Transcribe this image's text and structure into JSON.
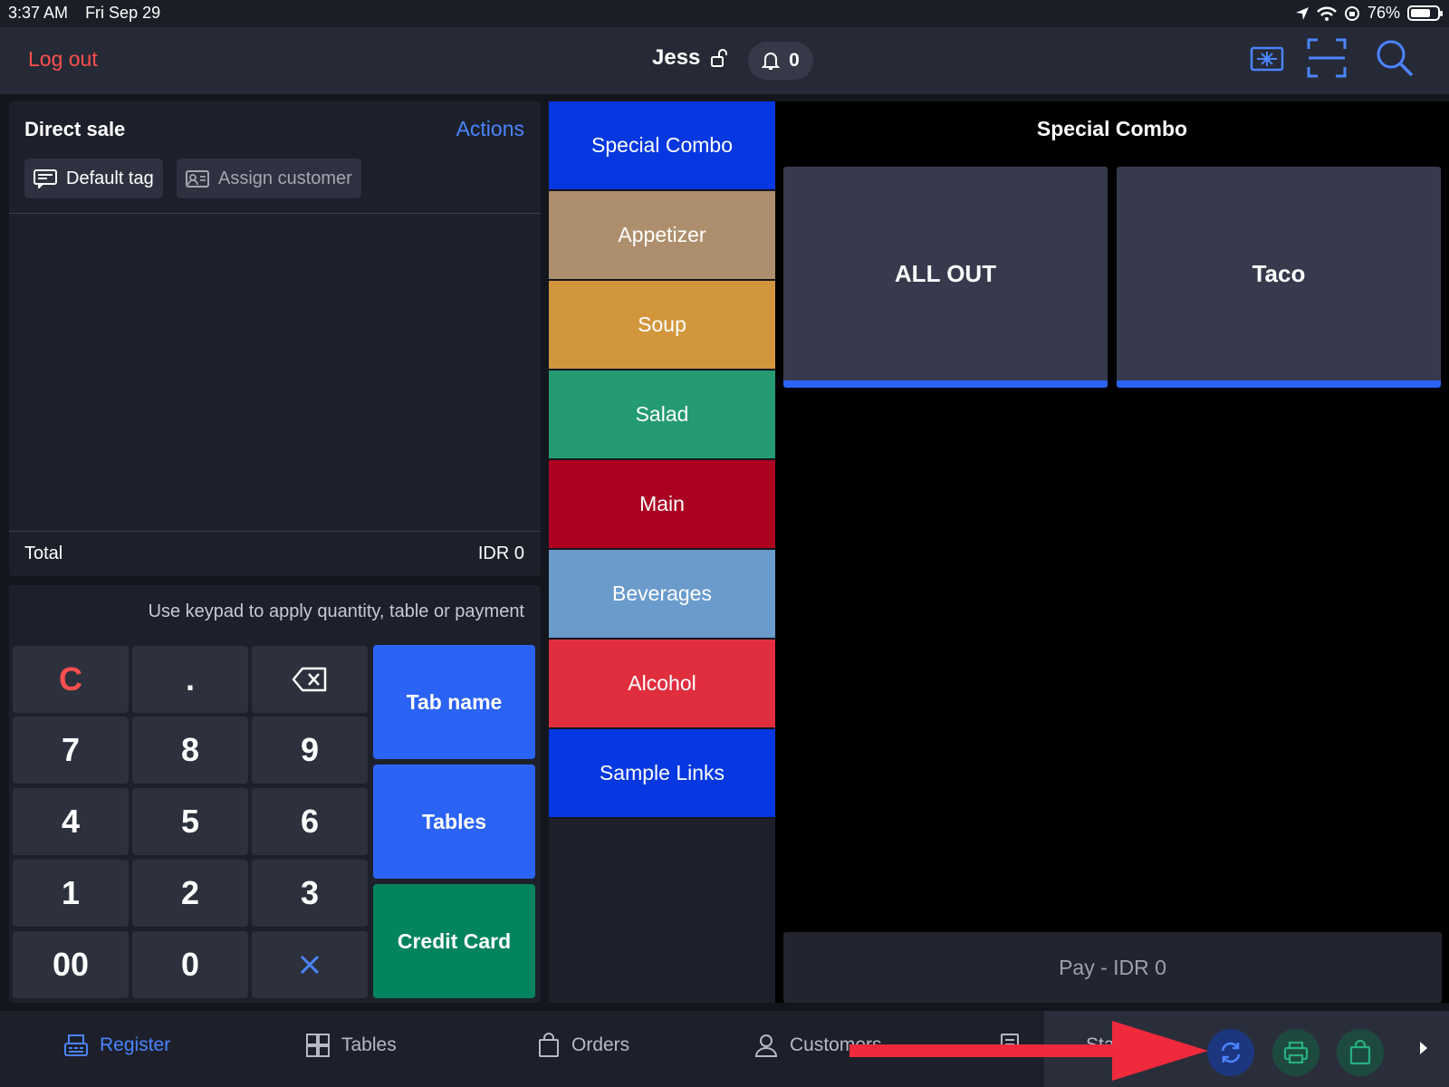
{
  "status_bar": {
    "time": "3:37 AM",
    "date": "Fri Sep 29",
    "battery": "76%",
    "battery_level": 0.76
  },
  "header": {
    "logout_label": "Log out",
    "user_name": "Jess",
    "notification_count": "0"
  },
  "order": {
    "title": "Direct sale",
    "actions_label": "Actions",
    "default_tag_label": "Default tag",
    "assign_customer_label": "Assign customer",
    "total_label": "Total",
    "total_value": "IDR 0"
  },
  "keypad": {
    "hint": "Use keypad to apply quantity, table or payment",
    "keys": [
      ".",
      "7",
      "8",
      "9",
      "4",
      "5",
      "6",
      "1",
      "2",
      "3",
      "00",
      "0"
    ],
    "clear_label": "C",
    "tab_name_label": "Tab name",
    "tables_label": "Tables",
    "credit_card_label": "Credit Card"
  },
  "categories": [
    {
      "label": "Special Combo",
      "color": "#0538e0"
    },
    {
      "label": "Appetizer",
      "color": "#ae8f6d"
    },
    {
      "label": "Soup",
      "color": "#d2973c"
    },
    {
      "label": "Salad",
      "color": "#249b71"
    },
    {
      "label": "Main",
      "color": "#ab0221"
    },
    {
      "label": "Beverages",
      "color": "#6a9bcb"
    },
    {
      "label": "Alcohol",
      "color": "#e12e3f"
    },
    {
      "label": "Sample Links",
      "color": "#0538e0"
    }
  ],
  "products": {
    "title": "Special Combo",
    "items": [
      {
        "label": "ALL OUT"
      },
      {
        "label": "Taco"
      }
    ],
    "pay_label": "Pay - IDR 0"
  },
  "tabbar": {
    "tabs": [
      {
        "label": "Register",
        "active": true
      },
      {
        "label": "Tables"
      },
      {
        "label": "Orders"
      },
      {
        "label": "Customers"
      }
    ],
    "partial_tab_label": "Status"
  },
  "colors": {
    "accent": "#2b63f5",
    "logout": "#ff4f4f",
    "credit_card": "#04845e",
    "arrow": "#ee2a3c"
  }
}
